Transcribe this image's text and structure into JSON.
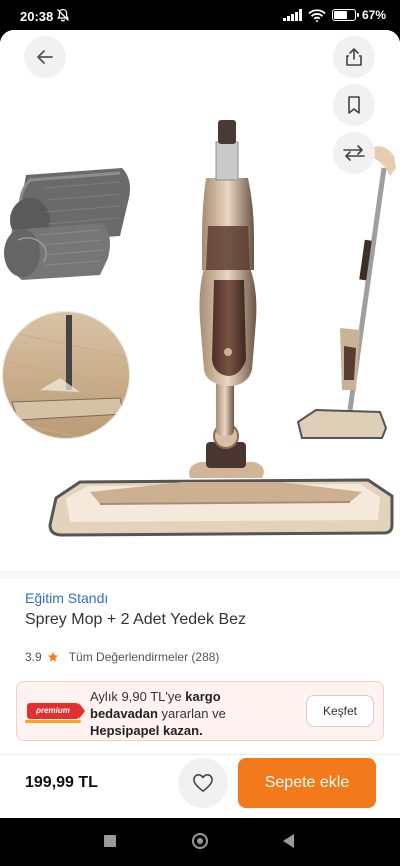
{
  "status_bar": {
    "time": "20:38",
    "battery": "67",
    "battery_pct_symbol": "%",
    "battery_level": 0.67,
    "icons": [
      "bell-off-icon",
      "signal-icon",
      "wifi-icon",
      "battery-icon"
    ]
  },
  "hero": {
    "icons": [
      "back-arrow-icon",
      "share-icon",
      "bookmark-icon",
      "compare-arrows-icon"
    ]
  },
  "product": {
    "brand": "Eğitim Standı",
    "title": "Sprey Mop + 2 Adet Yedek Bez",
    "rating": "3.9",
    "reviews_label": "Tüm Değerlendirmeler (288)"
  },
  "promo": {
    "badge": "premium",
    "line_1_a": "Aylık 9,90 TL'ye ",
    "line_1_b": "kargo",
    "line_2_b": "bedavadan",
    "line_2_a": " yararlan ve",
    "line_3_b": "Hepsipapel kazan.",
    "button": "Keşfet"
  },
  "bottom": {
    "price": "199,99 TL",
    "add_to_cart": "Sepete ekle"
  },
  "colors": {
    "brand_link": "#2f6fc6",
    "accent_orange": "#f27a1a",
    "star": "#f27a1a",
    "premium_red": "#e52f2f",
    "promo_bg": "#fff2f1"
  }
}
